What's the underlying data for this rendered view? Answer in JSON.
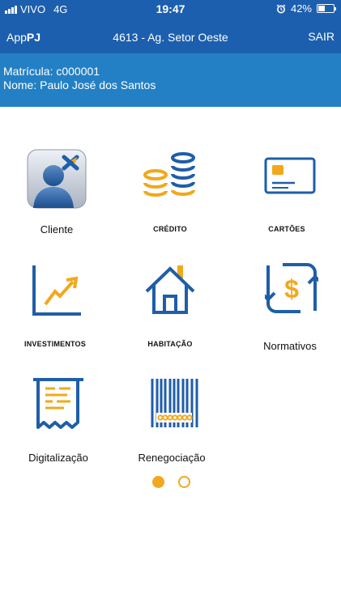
{
  "status_bar": {
    "carrier": "VIVO",
    "network": "4G",
    "time": "19:47",
    "battery": "42%",
    "battery_level": 0.42,
    "icons": [
      "signal-icon",
      "alarm-icon",
      "battery-icon"
    ]
  },
  "header": {
    "app_name_prefix": "App",
    "app_name_suffix": "PJ",
    "agency": "4613 - Ag. Setor Oeste",
    "logout_label": "SAIR"
  },
  "user": {
    "registration": "Matrícula: c000001",
    "name": "Nome: Paulo José dos Santos"
  },
  "menu": {
    "items": [
      {
        "label": "Cliente",
        "icon": "client-avatar-icon"
      },
      {
        "label": "CRÉDITO",
        "icon": "coins-stack-icon"
      },
      {
        "label": "CARTÕES",
        "icon": "credit-card-icon"
      },
      {
        "label": "INVESTIMENTOS",
        "icon": "growth-chart-icon"
      },
      {
        "label": "HABITAÇÃO",
        "icon": "house-icon"
      },
      {
        "label": "Normativos",
        "icon": "dollar-exchange-icon"
      },
      {
        "label": "Digitalização",
        "icon": "receipt-icon"
      },
      {
        "label": "Renegociação",
        "icon": "barcode-icon"
      }
    ]
  },
  "pager": {
    "pages": 2,
    "current": 1
  },
  "colors": {
    "header_blue": "#1c5fae",
    "userbar_blue": "#2480c4",
    "icon_blue": "#1f5ea8",
    "icon_orange": "#f2a81c"
  }
}
